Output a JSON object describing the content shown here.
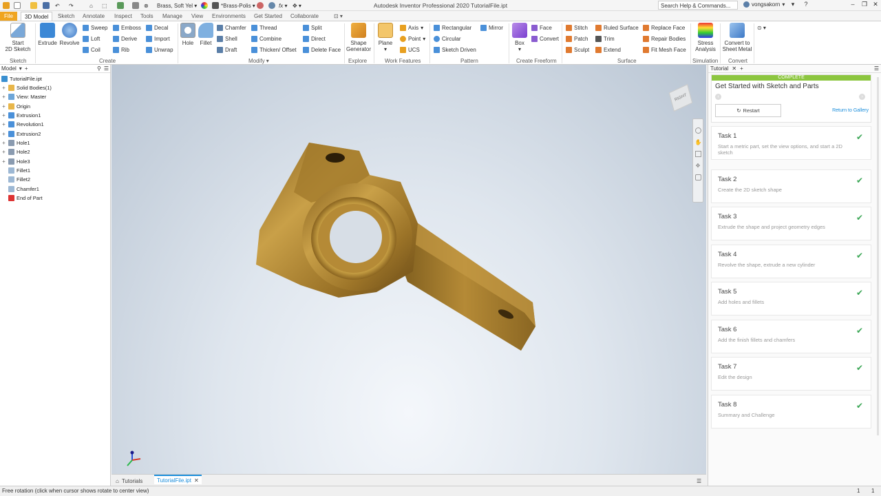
{
  "window_title": "Autodesk Inventor Professional 2020    TutorialFile.ipt",
  "qat": {
    "material": "Brass, Soft Yel",
    "appearance": "*Brass-Polis",
    "search_placeholder": "Search Help & Commands...",
    "user": "vongsakorn"
  },
  "tabs": [
    "File",
    "3D Model",
    "Sketch",
    "Annotate",
    "Inspect",
    "Tools",
    "Manage",
    "View",
    "Environments",
    "Get Started",
    "Collaborate"
  ],
  "ribbon": {
    "sketch": {
      "start": "Start",
      "start2": "2D Sketch",
      "panel": "Sketch"
    },
    "create": {
      "extrude": "Extrude",
      "revolve": "Revolve",
      "sweep": "Sweep",
      "loft": "Loft",
      "coil": "Coil",
      "emboss": "Emboss",
      "derive": "Derive",
      "rib": "Rib",
      "decal": "Decal",
      "import": "Import",
      "unwrap": "Unwrap",
      "panel": "Create"
    },
    "modify": {
      "hole": "Hole",
      "fillet": "Fillet",
      "chamfer": "Chamfer",
      "shell": "Shell",
      "draft": "Draft",
      "thread": "Thread",
      "combine": "Combine",
      "thicken": "Thicken/ Offset",
      "split": "Split",
      "direct": "Direct",
      "delete_face": "Delete Face",
      "panel": "Modify"
    },
    "explore": {
      "shape_gen": "Shape",
      "shape_gen2": "Generator",
      "panel": "Explore"
    },
    "work": {
      "plane": "Plane",
      "axis": "Axis",
      "point": "Point",
      "ucs": "UCS",
      "panel": "Work Features"
    },
    "pattern": {
      "rectangular": "Rectangular",
      "circular": "Circular",
      "sketch_driven": "Sketch Driven",
      "mirror": "Mirror",
      "panel": "Pattern"
    },
    "freeform": {
      "box": "Box",
      "face": "Face",
      "convert": "Convert",
      "panel": "Create Freeform"
    },
    "surface": {
      "stitch": "Stitch",
      "patch": "Patch",
      "sculpt": "Sculpt",
      "ruled": "Ruled Surface",
      "trim": "Trim",
      "extend": "Extend",
      "replace": "Replace Face",
      "repair": "Repair Bodies",
      "fitmesh": "Fit Mesh Face",
      "panel": "Surface"
    },
    "simulation": {
      "stress": "Stress",
      "stress2": "Analysis",
      "panel": "Simulation"
    },
    "convert": {
      "sheet": "Convert to",
      "sheet2": "Sheet Metal",
      "panel": "Convert"
    }
  },
  "model_panel": {
    "title": "Model",
    "items": [
      {
        "label": "TutorialFile.ipt",
        "indent": 0,
        "expand": "",
        "color": "#3a8fd0"
      },
      {
        "label": "Solid Bodies(1)",
        "indent": 1,
        "expand": "+",
        "color": "#e8b64a"
      },
      {
        "label": "View: Master",
        "indent": 1,
        "expand": "+",
        "color": "#6ea6d8"
      },
      {
        "label": "Origin",
        "indent": 1,
        "expand": "+",
        "color": "#e8b64a"
      },
      {
        "label": "Extrusion1",
        "indent": 1,
        "expand": "+",
        "color": "#4a90d9"
      },
      {
        "label": "Revolution1",
        "indent": 1,
        "expand": "+",
        "color": "#4a90d9"
      },
      {
        "label": "Extrusion2",
        "indent": 1,
        "expand": "+",
        "color": "#4a90d9"
      },
      {
        "label": "Hole1",
        "indent": 1,
        "expand": "+",
        "color": "#8a9bb0"
      },
      {
        "label": "Hole2",
        "indent": 1,
        "expand": "+",
        "color": "#8a9bb0"
      },
      {
        "label": "Hole3",
        "indent": 1,
        "expand": "+",
        "color": "#8a9bb0"
      },
      {
        "label": "Fillet1",
        "indent": 1,
        "expand": "",
        "color": "#9db8d4"
      },
      {
        "label": "Fillet2",
        "indent": 1,
        "expand": "",
        "color": "#9db8d4"
      },
      {
        "label": "Chamfer1",
        "indent": 1,
        "expand": "",
        "color": "#9db8d4"
      },
      {
        "label": "End of Part",
        "indent": 1,
        "expand": "",
        "color": "#d33"
      }
    ]
  },
  "viewcube_label": "RIGHT",
  "doc_tabs": {
    "home": "Tutorials",
    "file": "TutorialFile.ipt"
  },
  "status": {
    "left": "Free rotation (click when cursor shows rotate to center view)",
    "r1": "1",
    "r2": "1"
  },
  "tutorial": {
    "tab": "Tutorial",
    "badge": "COMPLETE",
    "title": "Get Started with Sketch and Parts",
    "restart": "Restart",
    "gallery": "Return to Gallery",
    "tasks": [
      {
        "name": "Task 1",
        "desc": "Start a metric part, set the view options, and start a 2D sketch"
      },
      {
        "name": "Task 2",
        "desc": "Create the 2D sketch shape"
      },
      {
        "name": "Task 3",
        "desc": "Extrude the shape and project geometry edges"
      },
      {
        "name": "Task 4",
        "desc": "Revolve the shape, extrude a new cylinder"
      },
      {
        "name": "Task 5",
        "desc": "Add holes and fillets"
      },
      {
        "name": "Task 6",
        "desc": "Add the finish fillets and chamfers"
      },
      {
        "name": "Task 7",
        "desc": "Edit the design"
      },
      {
        "name": "Task 8",
        "desc": "Summary and Challenge"
      }
    ]
  },
  "colors": {
    "file_tab": "#f0a520",
    "complete": "#8cc63f",
    "check": "#3aa655",
    "accent": "#1a8ddb",
    "brass": "#b8923a"
  }
}
